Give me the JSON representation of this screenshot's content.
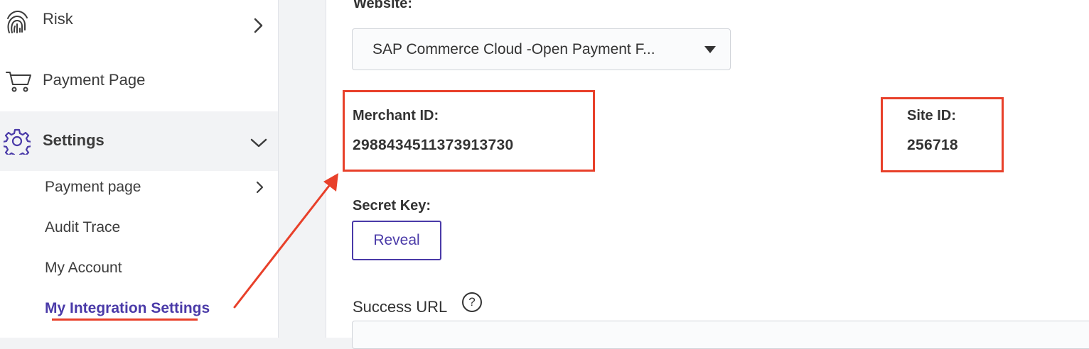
{
  "sidebar": {
    "items": [
      {
        "label": "Risk",
        "icon": "fingerprint-icon"
      },
      {
        "label": "Payment Page",
        "icon": "cart-icon"
      },
      {
        "label": "Settings",
        "icon": "gear-icon"
      }
    ],
    "sub_items": [
      {
        "label": "Payment page"
      },
      {
        "label": "Audit Trace"
      },
      {
        "label": "My Account"
      },
      {
        "label": "My Integration Settings"
      }
    ]
  },
  "form": {
    "website_label": "Website:",
    "website_value": "SAP Commerce Cloud -Open Payment F...",
    "merchant_id_label": "Merchant ID:",
    "merchant_id_value": "2988434511373913730",
    "site_id_label": "Site ID:",
    "site_id_value": "256718",
    "secret_key_label": "Secret Key:",
    "reveal_label": "Reveal",
    "success_url_label": "Success URL",
    "help_glyph": "?"
  },
  "colors": {
    "accent": "#4a3aa8",
    "annotation": "#e8402a"
  }
}
